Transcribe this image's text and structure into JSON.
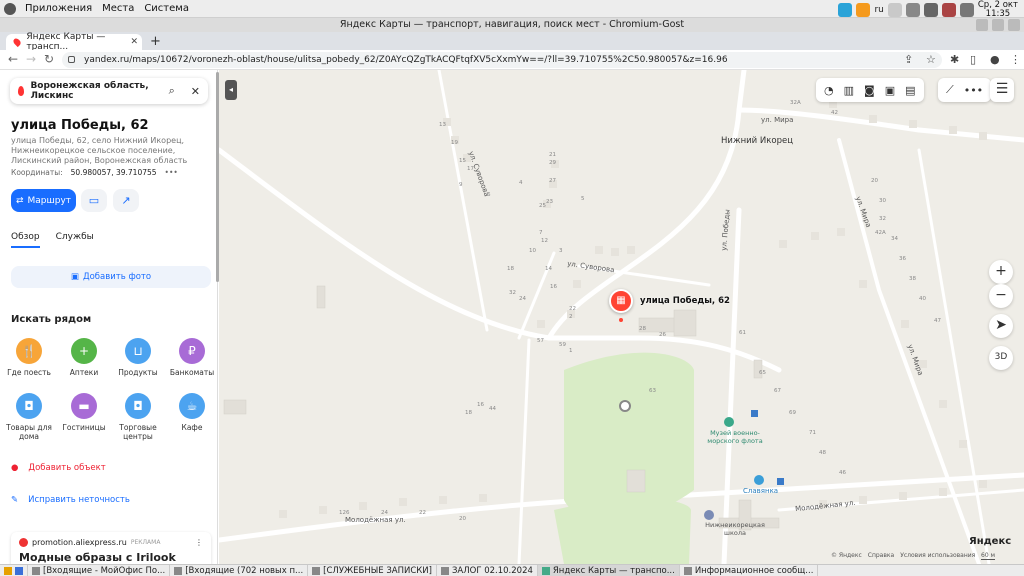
{
  "system_bar": {
    "menus": [
      "Приложения",
      "Места",
      "Система"
    ],
    "layout": "ru",
    "clock_day": "Ср, 2 окт",
    "clock_time": "11:35"
  },
  "window_title": "Яндекс Карты — транспорт, навигация, поиск мест - Chromium-Gost",
  "browser": {
    "tab_title": "Яндекс Карты — трансп...",
    "url": "yandex.ru/maps/10672/voronezh-oblast/house/ulitsa_pobedy_62/Z0AYcQZgTkACQFtqfXV5cXxmYw==/?ll=39.710755%2C50.980057&z=16.96"
  },
  "sidebar": {
    "search_value": "Воронежская область, Лискинс",
    "title": "улица Победы, 62",
    "subtitle": "улица Победы, 62, село Нижний Икорец, Нижнеикорецкое сельское поселение, Лискинский район, Воронежская область",
    "coords_label": "Координаты:",
    "coords_value": "50.980057, 39.710755",
    "coords_more": "•••",
    "route_label": "Маршрут",
    "tabs": [
      "Обзор",
      "Службы"
    ],
    "add_photo": "Добавить фото",
    "nearby_title": "Искать рядом",
    "categories": [
      {
        "label": "Где поесть",
        "color": "#f7a539",
        "icon": "fork-icon"
      },
      {
        "label": "Аптеки",
        "color": "#55b548",
        "icon": "plus-icon"
      },
      {
        "label": "Продукты",
        "color": "#4ca3f0",
        "icon": "basket-icon"
      },
      {
        "label": "Банкоматы",
        "color": "#a86bd6",
        "icon": "ruble-icon"
      },
      {
        "label": "Товары для дома",
        "color": "#4ca3f0",
        "icon": "bag-icon"
      },
      {
        "label": "Гостиницы",
        "color": "#a86bd6",
        "icon": "bed-icon"
      },
      {
        "label": "Торговые центры",
        "color": "#4ca3f0",
        "icon": "bag-icon"
      },
      {
        "label": "Кафе",
        "color": "#4ca3f0",
        "icon": "cup-icon"
      }
    ],
    "add_object": "Добавить объект",
    "fix_error": "Исправить неточность",
    "ad_domain": "promotion.aliexpress.ru",
    "ad_tag": "РЕКЛАМА",
    "ad_title": "Модные образы с Irilook"
  },
  "map": {
    "marker_label": "улица Победы, 62",
    "village": "Нижний Икорец",
    "streets": [
      "ул. Мира",
      "ул. Суворова",
      "ул. Победы",
      "ул. Мира",
      "ул. Мира",
      "Молодёжная ул."
    ],
    "street_suvorova_2": "ул. Суворова",
    "poi_museum": "Музей военно-морского флота",
    "poi_church": "Славянка",
    "poi_school": "Нижнеикорецкая школа",
    "house_numbers": [
      "32А",
      "42",
      "25",
      "23",
      "27",
      "29",
      "21",
      "13",
      "19",
      "15",
      "17",
      "9",
      "6",
      "4",
      "5",
      "7",
      "3",
      "10",
      "12",
      "14",
      "16",
      "18",
      "20",
      "30",
      "32",
      "34",
      "36",
      "38",
      "40",
      "47",
      "42А",
      "63",
      "28",
      "26",
      "24",
      "22",
      "1",
      "2",
      "32",
      "57",
      "59",
      "61",
      "65",
      "67",
      "69",
      "71",
      "48",
      "46",
      "44",
      "16",
      "18",
      "20",
      "22",
      "24",
      "126"
    ],
    "brand": "Яндекс",
    "footer": [
      "© Яндекс",
      "Справка",
      "Условия использования"
    ],
    "scale": "60 м",
    "btn_3d": "3D"
  },
  "taskbar": {
    "items": [
      "[Входящие - МойОфис По...",
      "[Входящие (702 новых п...",
      "[СЛУЖЕБНЫЕ ЗАПИСКИ]",
      "ЗАЛОГ 02.10.2024",
      "Яндекс Карты — транспо...",
      "Информационное сообщ..."
    ]
  }
}
